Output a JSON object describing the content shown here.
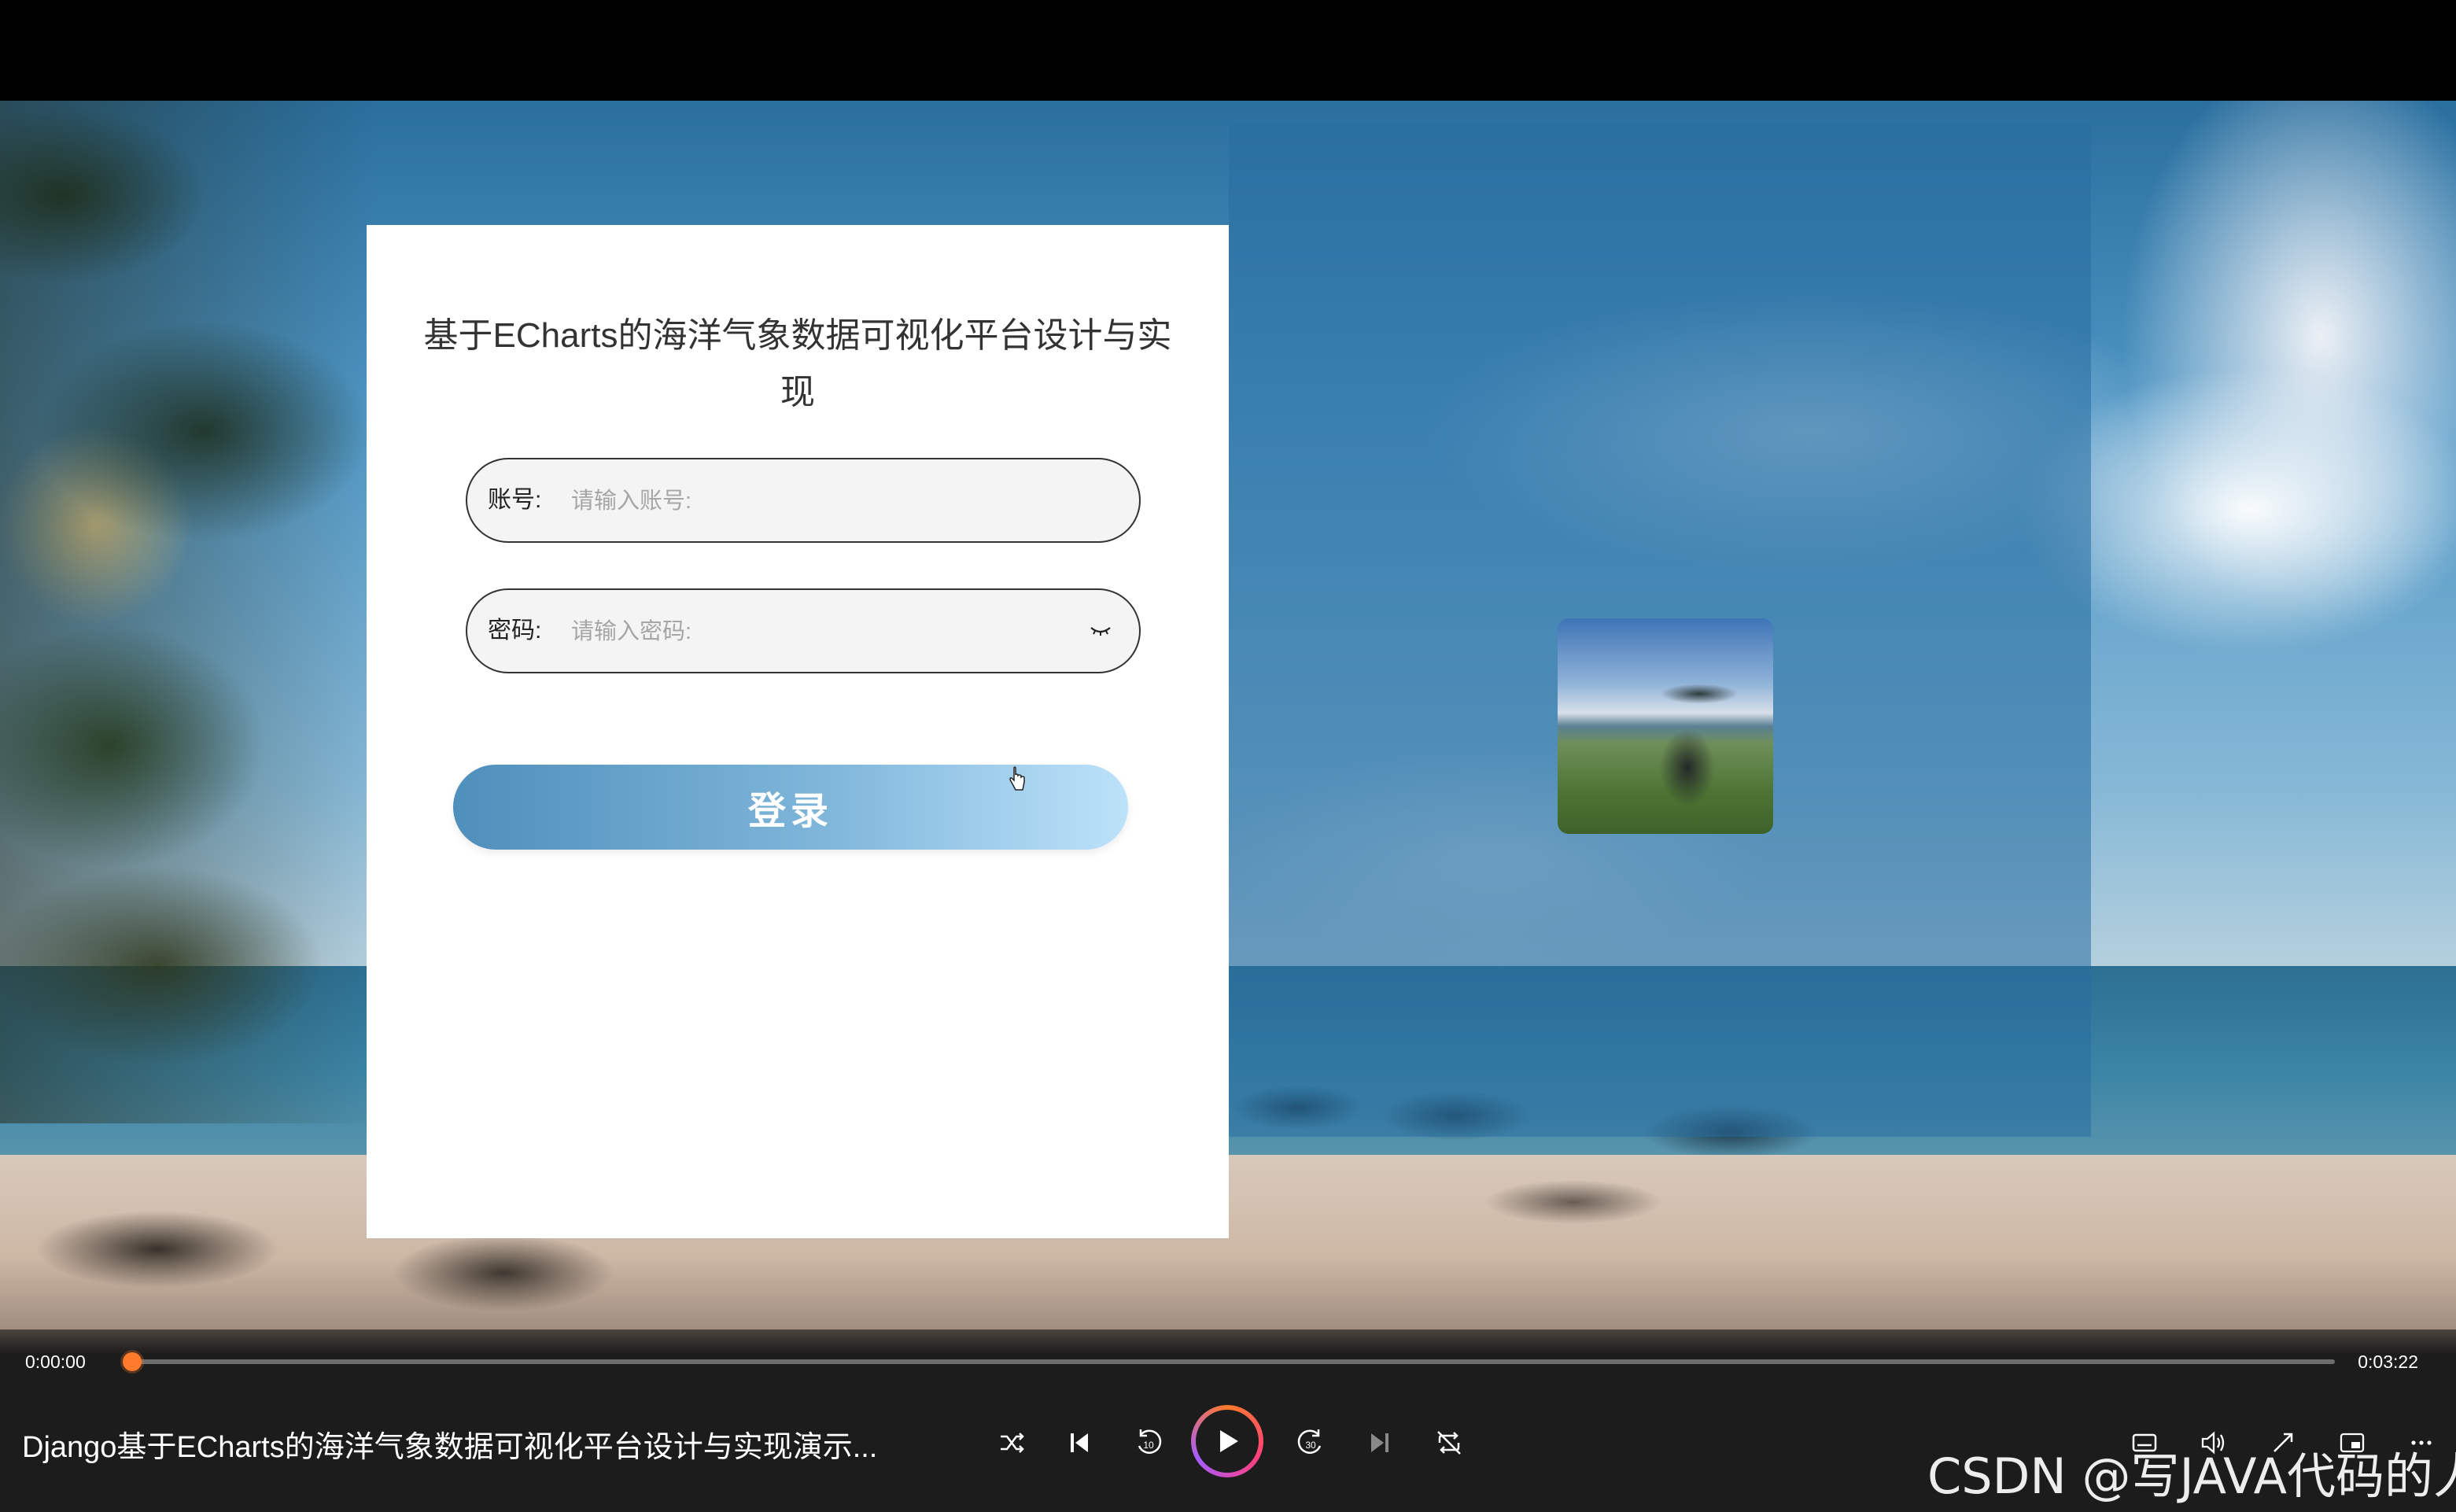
{
  "login": {
    "title": "基于ECharts的海洋气象数据可视化平台设计与实现",
    "account_label": "账号:",
    "account_placeholder": "请输入账号:",
    "password_label": "密码:",
    "password_placeholder": "请输入密码:",
    "submit_label": "登录"
  },
  "player": {
    "current_time": "0:00:00",
    "total_time": "0:03:22",
    "progress": 0,
    "video_title": "Django基于ECharts的海洋气象数据可视化平台设计与实现演示...",
    "accent": "#ff7a2a"
  },
  "watermark": "CSDN @写JAVA代码的人",
  "icons": [
    "eye-closed-icon",
    "shuffle-icon",
    "previous-icon",
    "rewind-10-icon",
    "play-icon",
    "forward-30-icon",
    "next-icon",
    "repeat-icon",
    "subtitles-icon",
    "volume-icon",
    "expand-icon",
    "miniplayer-icon",
    "more-icon"
  ]
}
